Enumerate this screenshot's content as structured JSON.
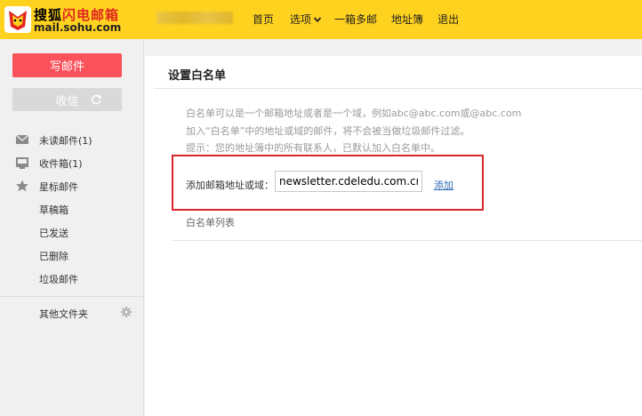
{
  "header": {
    "logo": {
      "title_part1": "搜狐",
      "title_part2": "闪电邮箱",
      "domain": "mail.sohu.com"
    },
    "nav": [
      {
        "label": "首页"
      },
      {
        "label": "选项"
      },
      {
        "label": "一箱多邮"
      },
      {
        "label": "地址簿"
      },
      {
        "label": "退出"
      }
    ]
  },
  "sidebar": {
    "compose_label": "写邮件",
    "receive_label": "收信",
    "folders": [
      {
        "label": "未读邮件(1)",
        "icon": "envelope-icon"
      },
      {
        "label": "收件箱(1)",
        "icon": "inbox-icon"
      },
      {
        "label": "星标邮件",
        "icon": "star-icon"
      },
      {
        "label": "草稿箱",
        "icon": ""
      },
      {
        "label": "已发送",
        "icon": ""
      },
      {
        "label": "已删除",
        "icon": ""
      },
      {
        "label": "垃圾邮件",
        "icon": ""
      }
    ],
    "other_folders_label": "其他文件夹"
  },
  "main": {
    "title": "设置白名单",
    "hints": [
      "白名单可以是一个邮箱地址或者是一个域，例如abc@abc.com或@abc.com",
      "加入“白名单”中的地址或域的邮件，将不会被当做垃圾邮件过滤。",
      "提示：您的地址簿中的所有联系人，已默认加入白名单中。"
    ],
    "add_label": "添加邮箱地址或域：",
    "add_input_value": "newsletter.cdeledu.com.cn",
    "add_link": "添加",
    "list_label": "白名单列表"
  },
  "colors": {
    "header_bg": "#ffd21f",
    "compose_bg": "#fa525a",
    "highlight_frame": "#d9262b",
    "link": "#2f6bb5"
  }
}
